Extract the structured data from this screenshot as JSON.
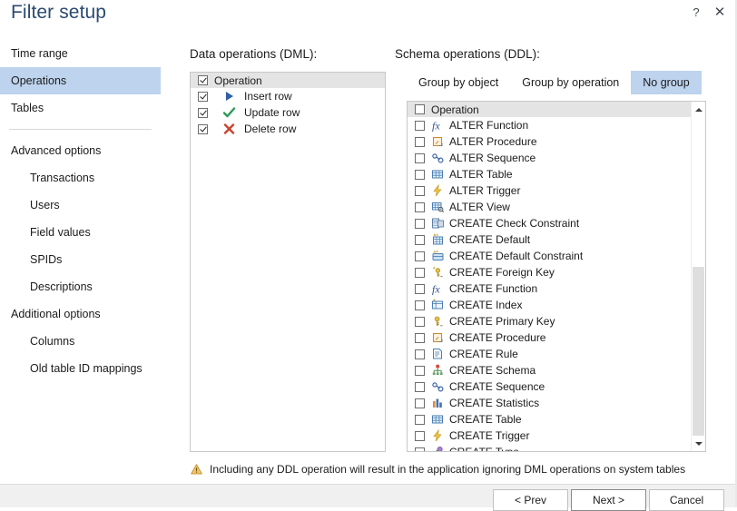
{
  "window": {
    "title": "Filter setup",
    "help_icon": "question-mark-icon",
    "close_icon": "close-icon",
    "help_label": "?",
    "close_label": "✕"
  },
  "sidebar": {
    "items": [
      {
        "label": "Time range",
        "level": 0,
        "selected": false
      },
      {
        "label": "Operations",
        "level": 0,
        "selected": true
      },
      {
        "label": "Tables",
        "level": 0,
        "selected": false
      },
      {
        "label": "Advanced options",
        "level": 0,
        "selected": false
      },
      {
        "label": "Transactions",
        "level": 1,
        "selected": false
      },
      {
        "label": "Users",
        "level": 1,
        "selected": false
      },
      {
        "label": "Field values",
        "level": 1,
        "selected": false
      },
      {
        "label": "SPIDs",
        "level": 1,
        "selected": false
      },
      {
        "label": "Descriptions",
        "level": 1,
        "selected": false
      },
      {
        "label": "Additional options",
        "level": 0,
        "selected": false
      },
      {
        "label": "Columns",
        "level": 1,
        "selected": false
      },
      {
        "label": "Old table ID mappings",
        "level": 1,
        "selected": false
      }
    ]
  },
  "dml_panel": {
    "heading": "Data operations (DML):",
    "header_row": {
      "label": "Operation",
      "checked": true
    },
    "rows": [
      {
        "label": "Insert row",
        "checked": true,
        "icon": "insert-row-icon"
      },
      {
        "label": "Update row",
        "checked": true,
        "icon": "update-row-icon"
      },
      {
        "label": "Delete row",
        "checked": true,
        "icon": "delete-row-icon"
      }
    ]
  },
  "ddl_panel": {
    "heading": "Schema operations (DDL):",
    "group_tabs": [
      {
        "label": "Group by object",
        "active": false
      },
      {
        "label": "Group by operation",
        "active": false
      },
      {
        "label": "No group",
        "active": true
      }
    ],
    "header_row": {
      "label": "Operation",
      "checked": false
    },
    "rows": [
      {
        "label": "ALTER Function",
        "checked": false,
        "icon": "function-icon"
      },
      {
        "label": "ALTER Procedure",
        "checked": false,
        "icon": "procedure-icon"
      },
      {
        "label": "ALTER Sequence",
        "checked": false,
        "icon": "sequence-icon"
      },
      {
        "label": "ALTER Table",
        "checked": false,
        "icon": "table-icon"
      },
      {
        "label": "ALTER Trigger",
        "checked": false,
        "icon": "trigger-icon"
      },
      {
        "label": "ALTER View",
        "checked": false,
        "icon": "view-icon"
      },
      {
        "label": "CREATE Check Constraint",
        "checked": false,
        "icon": "check-constraint-icon"
      },
      {
        "label": "CREATE Default",
        "checked": false,
        "icon": "default-icon"
      },
      {
        "label": "CREATE Default Constraint",
        "checked": false,
        "icon": "default-constraint-icon"
      },
      {
        "label": "CREATE Foreign Key",
        "checked": false,
        "icon": "foreign-key-icon"
      },
      {
        "label": "CREATE Function",
        "checked": false,
        "icon": "function-icon"
      },
      {
        "label": "CREATE Index",
        "checked": false,
        "icon": "index-icon"
      },
      {
        "label": "CREATE Primary Key",
        "checked": false,
        "icon": "primary-key-icon"
      },
      {
        "label": "CREATE Procedure",
        "checked": false,
        "icon": "procedure-icon"
      },
      {
        "label": "CREATE Rule",
        "checked": false,
        "icon": "rule-icon"
      },
      {
        "label": "CREATE Schema",
        "checked": false,
        "icon": "schema-icon"
      },
      {
        "label": "CREATE Sequence",
        "checked": false,
        "icon": "sequence-icon"
      },
      {
        "label": "CREATE Statistics",
        "checked": false,
        "icon": "statistics-icon"
      },
      {
        "label": "CREATE Table",
        "checked": false,
        "icon": "table-icon"
      },
      {
        "label": "CREATE Trigger",
        "checked": false,
        "icon": "trigger-icon"
      },
      {
        "label": "CREATE Type",
        "checked": false,
        "icon": "type-icon"
      }
    ],
    "scrollbar": {
      "thumb_top_pct": 47,
      "thumb_height_pct": 53
    }
  },
  "warning": {
    "icon": "warning-triangle-icon",
    "text": "Including any DDL operation will result in the application ignoring DML operations on system tables"
  },
  "footer": {
    "prev_label": "< Prev",
    "next_label": "Next >",
    "cancel_label": "Cancel"
  },
  "colors": {
    "accent_selection": "#bdd3ee",
    "title_blue": "#2b4a6f",
    "header_row_gray": "#e4e4e4",
    "footer_gray": "#f0f0f0",
    "insert_blue": "#2f5fa8",
    "update_green": "#2e9b57",
    "delete_red": "#c8462f",
    "warning_amber": "#d9a62a"
  }
}
